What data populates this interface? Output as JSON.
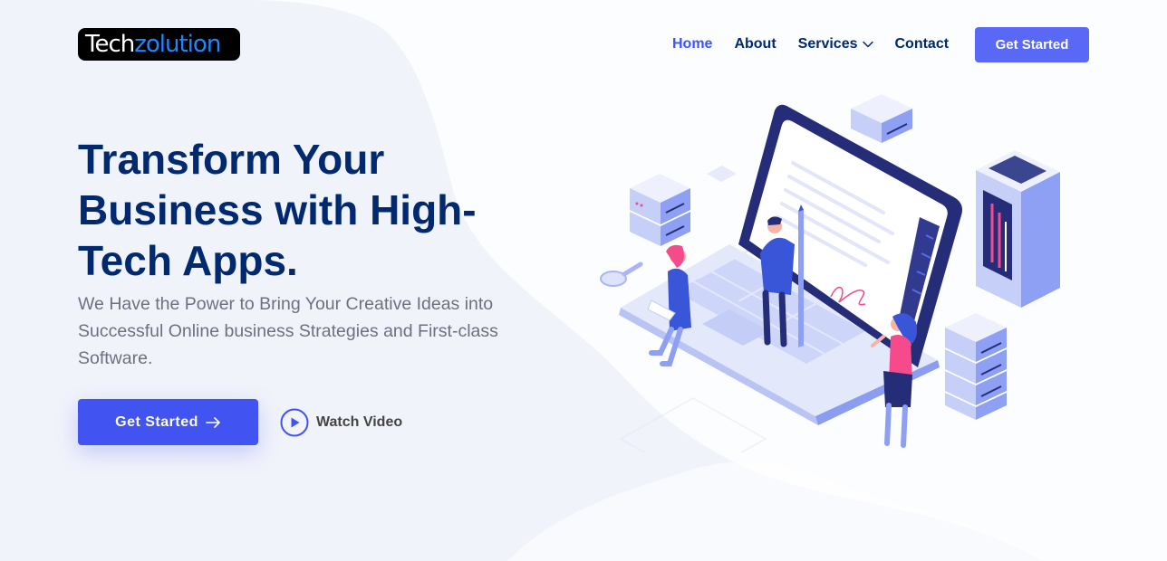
{
  "brand": {
    "logo_part1": "Tech",
    "logo_part2": "zolution"
  },
  "nav": {
    "items": [
      {
        "label": "Home",
        "active": true
      },
      {
        "label": "About",
        "active": false
      },
      {
        "label": "Services",
        "active": false,
        "has_dropdown": true
      },
      {
        "label": "Contact",
        "active": false
      }
    ],
    "cta_label": "Get Started"
  },
  "hero": {
    "title": "Transform Your Business with High-Tech Apps.",
    "subtitle": "We Have the Power to Bring Your Creative Ideas into Successful Online business Strategies and First-class Software.",
    "primary_cta": "Get Started",
    "primary_cta_icon": "arrow-right-icon",
    "secondary_cta": "Watch Video",
    "secondary_cta_icon": "play-circle-icon"
  },
  "illustration": {
    "name": "isometric-laptop-team-illustration"
  },
  "colors": {
    "primary": "#4154f1",
    "nav_cta": "#5969f6",
    "heading": "#012970",
    "body_text": "#6c7082",
    "background": "#f1f3fb",
    "accent_pink": "#f54a8c"
  }
}
